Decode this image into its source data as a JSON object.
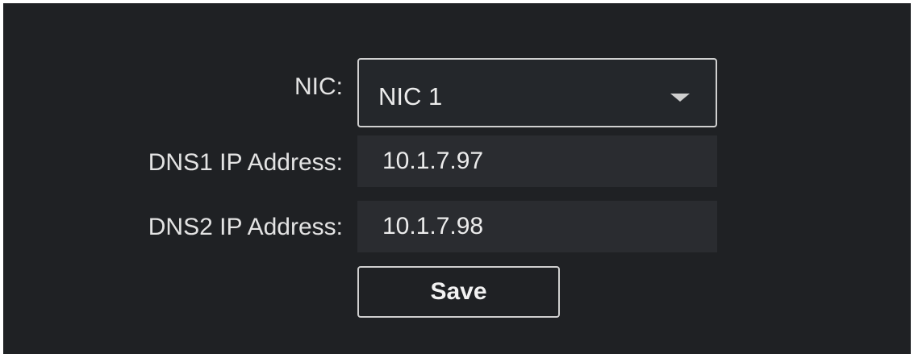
{
  "form": {
    "nic": {
      "label": "NIC:",
      "selected": "NIC 1"
    },
    "dns1": {
      "label": "DNS1 IP Address:",
      "value": "10.1.7.97"
    },
    "dns2": {
      "label": "DNS2 IP Address:",
      "value": "10.1.7.98"
    },
    "save_label": "Save"
  },
  "icons": {
    "dropdown": "chevron-down-icon"
  },
  "colors": {
    "background": "#1f2124",
    "field_background": "#2a2c30",
    "border": "#d0d0d0",
    "text": "#e3e3e3"
  }
}
